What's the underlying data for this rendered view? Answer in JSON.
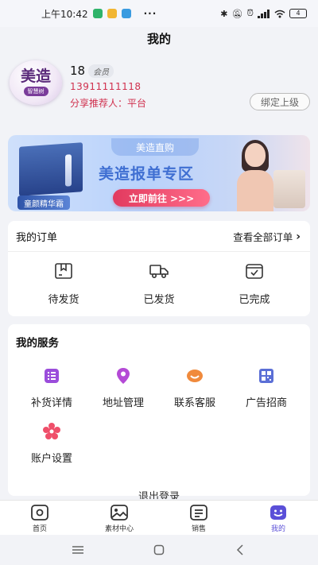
{
  "status_bar": {
    "time": "上午10:42",
    "dots": "···",
    "battery": "4"
  },
  "page": {
    "title": "我的"
  },
  "profile": {
    "avatar_logo": "美造",
    "avatar_sub": "智慧树",
    "name": "18",
    "member_badge": "会员",
    "phone": "13911111118",
    "referrer": "分享推荐人：平台",
    "bind_button": "绑定上级"
  },
  "banner": {
    "tag": "美造直购",
    "headline": "美造报单专区",
    "cta": "立即前往 >>>",
    "product_label": "童颜精华霜"
  },
  "orders": {
    "title": "我的订单",
    "view_all": "查看全部订单",
    "items": [
      {
        "label": "待发货",
        "icon": "package-icon"
      },
      {
        "label": "已发货",
        "icon": "truck-icon"
      },
      {
        "label": "已完成",
        "icon": "check-box-icon"
      }
    ]
  },
  "services": {
    "title": "我的服务",
    "items": [
      {
        "label": "补货详情",
        "icon": "list-icon",
        "color": "#9b4ddb"
      },
      {
        "label": "地址管理",
        "icon": "location-pin-icon",
        "color": "#b44ad6"
      },
      {
        "label": "联系客服",
        "icon": "customer-service-icon",
        "color": "#f08a3c"
      },
      {
        "label": "广告招商",
        "icon": "qr-code-icon",
        "color": "#5b6fd6"
      },
      {
        "label": "账户设置",
        "icon": "settings-flower-icon",
        "color": "#ef4f6a"
      }
    ]
  },
  "logout": "退出登录",
  "tabs": [
    {
      "label": "首页",
      "icon": "home-icon",
      "active": false
    },
    {
      "label": "素材中心",
      "icon": "image-icon",
      "active": false
    },
    {
      "label": "销售",
      "icon": "document-icon",
      "active": false
    },
    {
      "label": "我的",
      "icon": "smile-icon",
      "active": true
    }
  ],
  "colors": {
    "accent": "#5a4fd8",
    "phone": "#d0304e",
    "cta": "#e23a5f"
  }
}
